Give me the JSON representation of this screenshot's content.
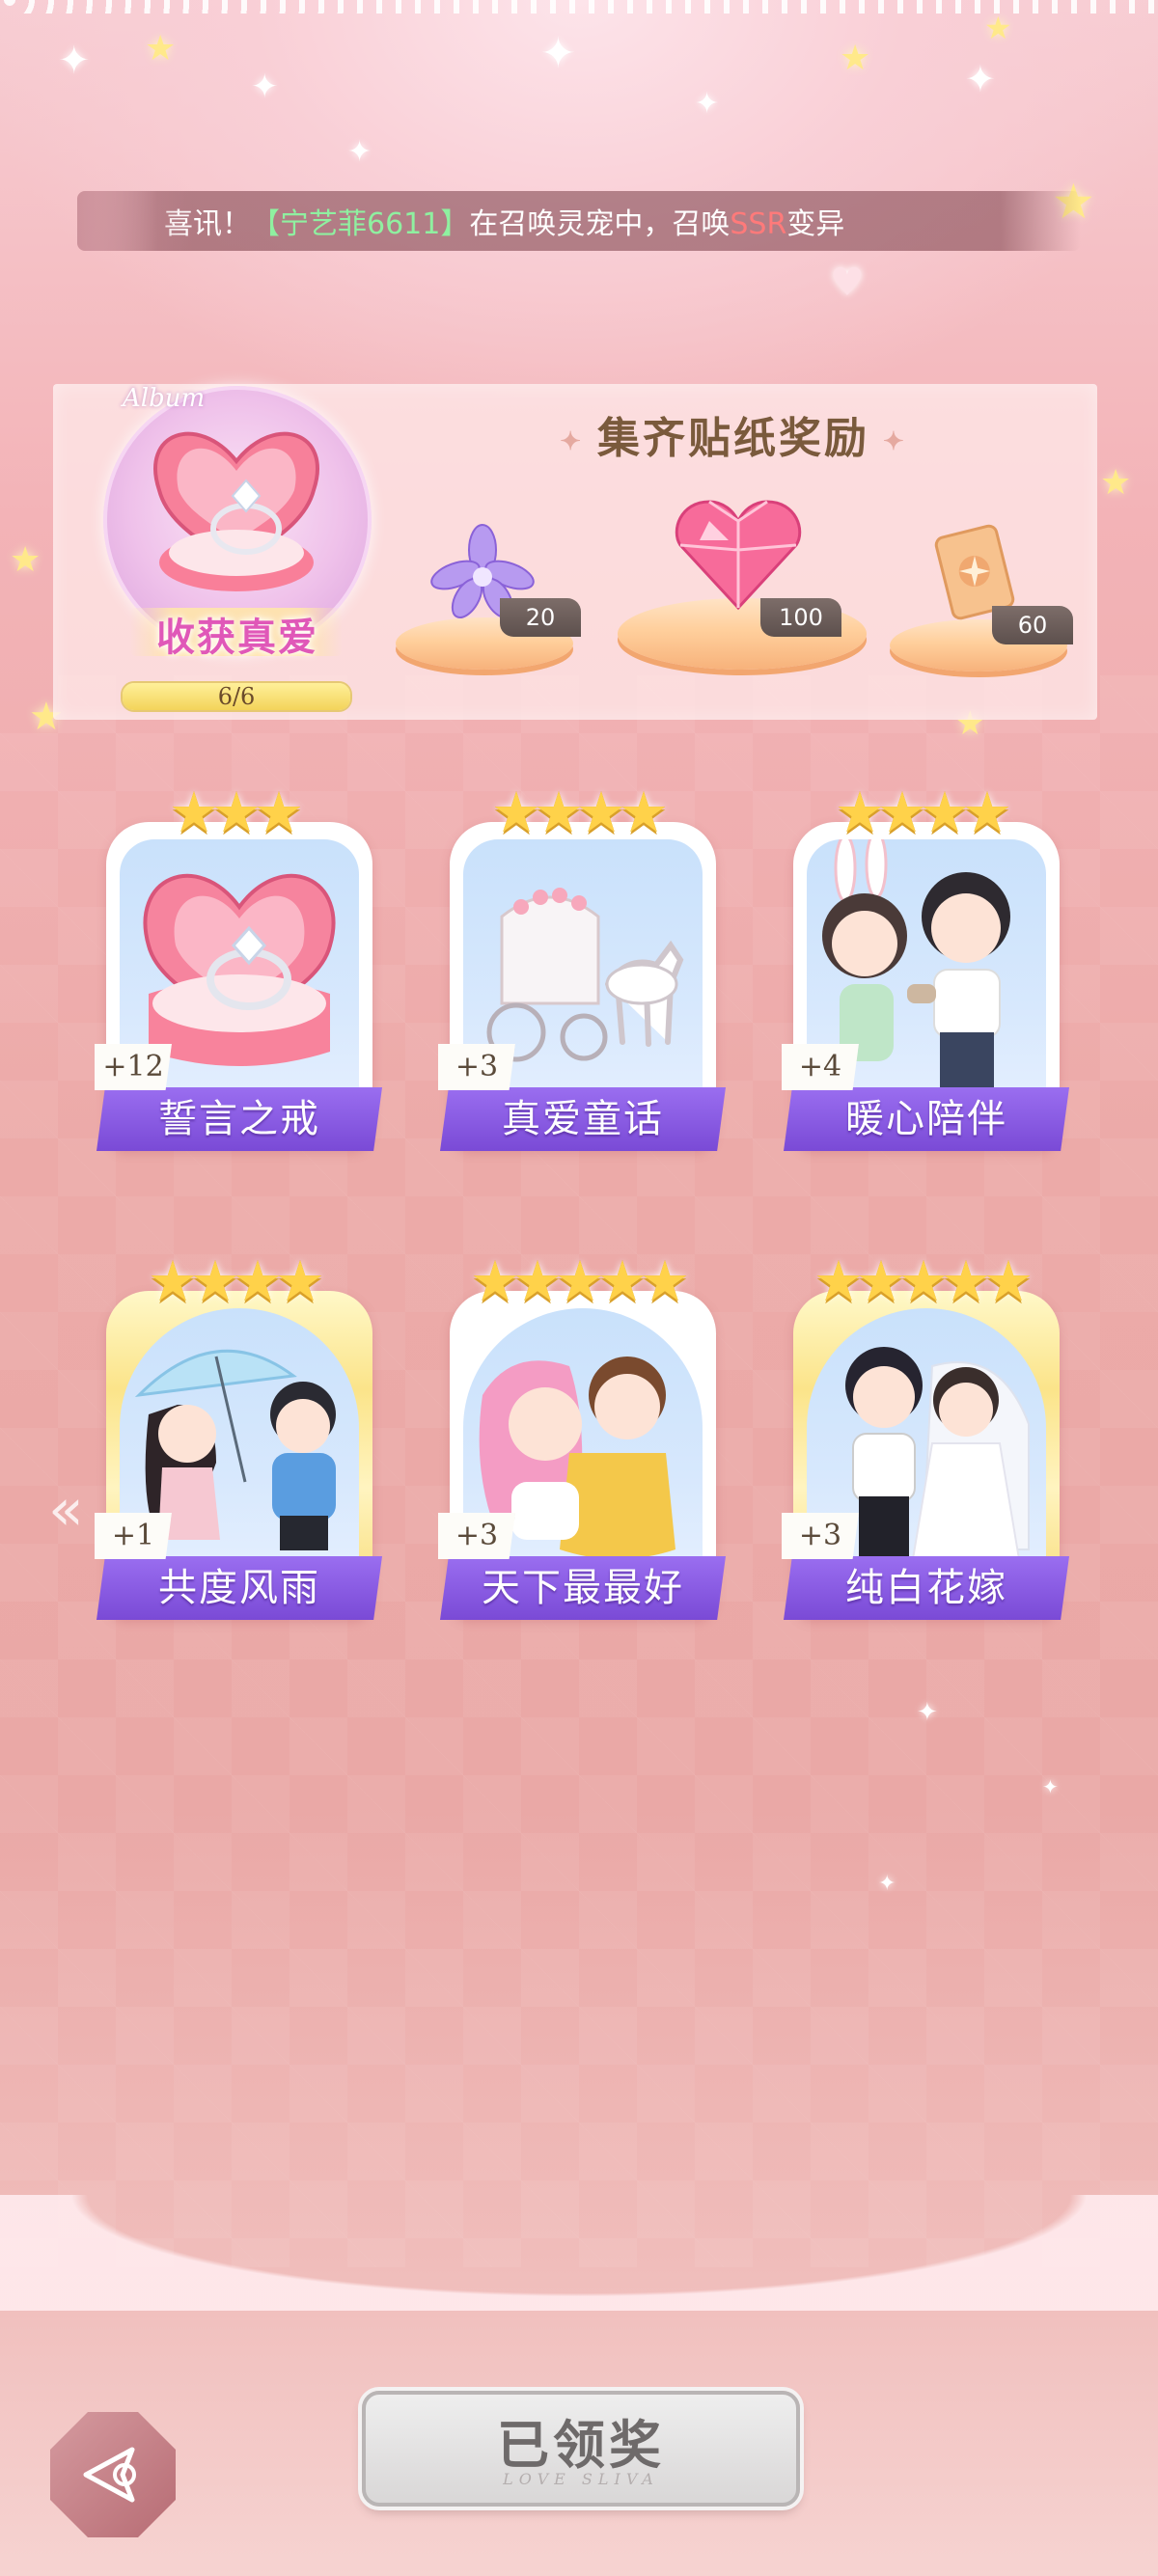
{
  "announcement": {
    "prefix": "喜讯！",
    "player": "【宁艺菲6611】",
    "middle": "在召唤灵宠中，召唤",
    "highlight": "SSR",
    "suffix": "变异"
  },
  "reward_panel": {
    "title": "集齐贴纸奖励",
    "album_word": "Album",
    "album_title": "收获真爱",
    "progress_text": "6/6",
    "progress_fraction": 1.0,
    "rewards": [
      {
        "name": "purple-flower",
        "count": "20"
      },
      {
        "name": "pink-heart-gem",
        "count": "100"
      },
      {
        "name": "card-pack",
        "count": "60"
      }
    ]
  },
  "stickers": [
    {
      "label": "誓言之戒",
      "badge": "+12",
      "stars": 3,
      "frame": "white"
    },
    {
      "label": "真爱童话",
      "badge": "+3",
      "stars": 4,
      "frame": "white"
    },
    {
      "label": "暖心陪伴",
      "badge": "+4",
      "stars": 4,
      "frame": "white"
    },
    {
      "label": "共度风雨",
      "badge": "+1",
      "stars": 4,
      "frame": "gold"
    },
    {
      "label": "天下最最好",
      "badge": "+3",
      "stars": 5,
      "frame": "white"
    },
    {
      "label": "纯白花嫁",
      "badge": "+3",
      "stars": 5,
      "frame": "gold"
    }
  ],
  "claim_button": {
    "label": "已领奖",
    "subtitle": "LOVE SLIVA"
  },
  "nav": {
    "prev_glyph": "«"
  },
  "colors": {
    "accent_purple": "#8a5ce6",
    "star_gold": "#ffd24a",
    "bg_pink": "#eaa8a6"
  }
}
